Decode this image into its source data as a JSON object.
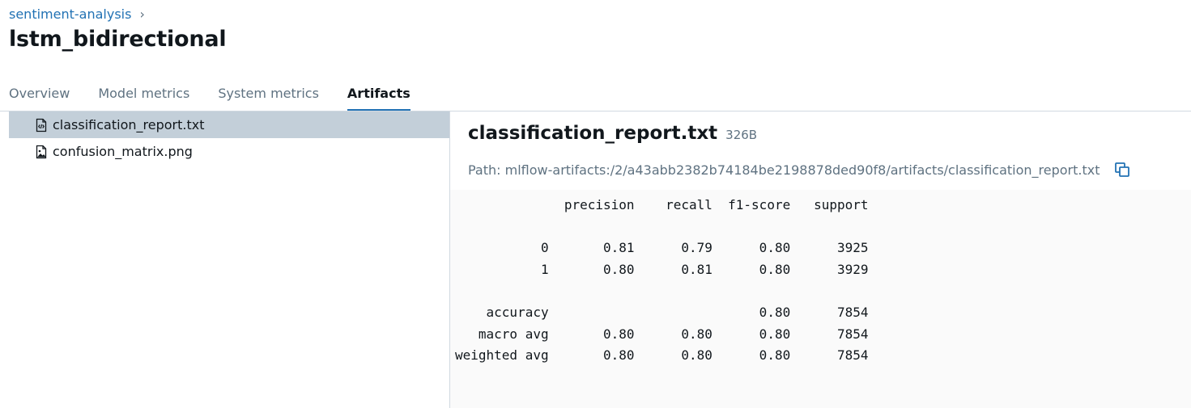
{
  "breadcrumb": {
    "experiment": "sentiment-analysis",
    "separator": "›"
  },
  "page": {
    "title": "lstm_bidirectional"
  },
  "tabs": [
    {
      "label": "Overview",
      "active": false
    },
    {
      "label": "Model metrics",
      "active": false
    },
    {
      "label": "System metrics",
      "active": false
    },
    {
      "label": "Artifacts",
      "active": true
    }
  ],
  "artifacts": {
    "files": [
      {
        "name": "classification_report.txt",
        "icon": "code-file-icon",
        "selected": true
      },
      {
        "name": "confusion_matrix.png",
        "icon": "image-file-icon",
        "selected": false
      }
    ]
  },
  "viewer": {
    "file_name": "classification_report.txt",
    "file_size": "326B",
    "path": "Path: mlflow-artifacts:/2/a43abb2382b74184be2198878ded90f8/artifacts/classification_report.txt",
    "copy_icon": "copy-icon",
    "content": "              precision    recall  f1-score   support\n\n           0       0.81      0.79      0.80      3925\n           1       0.80      0.81      0.80      3929\n\n    accuracy                           0.80      7854\n   macro avg       0.80      0.80      0.80      7854\nweighted avg       0.80      0.80      0.80      7854"
  },
  "colors": {
    "accent": "#2272b4",
    "selected_row": "#c3cfd9",
    "muted_text": "#5f7281",
    "border": "#d1d9e1"
  }
}
